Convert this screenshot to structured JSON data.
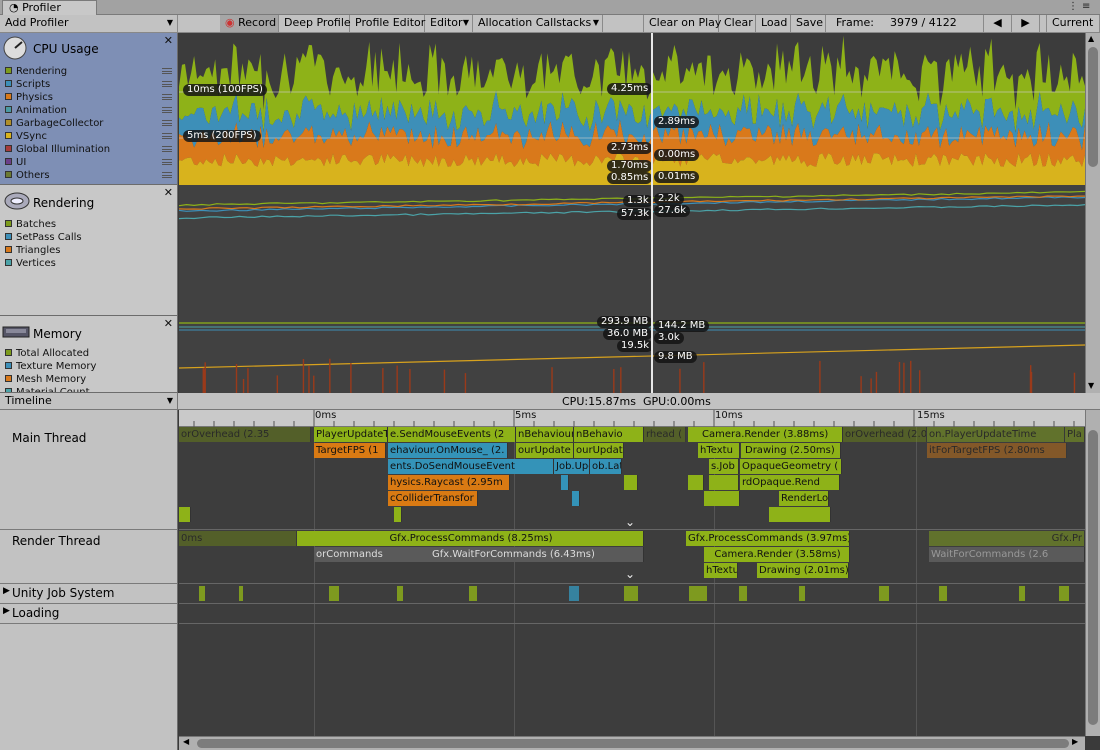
{
  "window": {
    "tab_title": "Profiler"
  },
  "toolbar": {
    "add_profiler": "Add Profiler",
    "record": "Record",
    "deep_profile": "Deep Profile",
    "profile_editor": "Profile Editor",
    "editor": "Editor",
    "allocation_callstacks": "Allocation Callstacks",
    "clear_on_play": "Clear on Play",
    "clear": "Clear",
    "load": "Load",
    "save": "Save",
    "frame_label": "Frame:",
    "frame_value": "3979 / 4122",
    "current": "Current"
  },
  "cpu": {
    "title": "CPU Usage",
    "legend": [
      "Rendering",
      "Scripts",
      "Physics",
      "Animation",
      "GarbageCollector",
      "VSync",
      "Global Illumination",
      "UI",
      "Others"
    ],
    "colors": [
      "#7d9c1c",
      "#3d8fb8",
      "#d9791b",
      "#4b9aa3",
      "#b08f2a",
      "#d8b31d",
      "#a63b3b",
      "#6b3f8a",
      "#6b7a32"
    ],
    "guide_10": "10ms (100FPS)",
    "guide_5": "5ms (200FPS)",
    "vals_left": [
      "4.25ms",
      "2.73ms",
      "1.70ms",
      "0.85ms"
    ],
    "vals_right": [
      "2.89ms",
      "0.00ms",
      "0.01ms"
    ]
  },
  "rendering": {
    "title": "Rendering",
    "legend": [
      "Batches",
      "SetPass Calls",
      "Triangles",
      "Vertices"
    ],
    "colors": [
      "#7d9c1c",
      "#3d8fb8",
      "#d9791b",
      "#4ba3a8"
    ],
    "vals_left": [
      "1.3k",
      "57.3k"
    ],
    "vals_right": [
      "2.2k",
      "27.6k"
    ]
  },
  "memory": {
    "title": "Memory",
    "legend": [
      "Total Allocated",
      "Texture Memory",
      "Mesh Memory",
      "Material Count"
    ],
    "colors": [
      "#7d9c1c",
      "#3d8fb8",
      "#d9791b",
      "#4ba3a8"
    ],
    "vals_left": [
      "293.9 MB",
      "36.0 MB",
      "19.5k"
    ],
    "vals_right": [
      "144.2 MB",
      "3.0k",
      "9.8 MB"
    ]
  },
  "timeline": {
    "view_mode": "Timeline",
    "cpu_label": "CPU:15.87ms",
    "gpu_label": "GPU:0.00ms",
    "ruler": [
      "0ms",
      "5ms",
      "10ms",
      "15ms"
    ],
    "threads": [
      "Main Thread",
      "Render Thread",
      "Unity Job System",
      "Loading"
    ],
    "main_bars": [
      "orOverhead (2.35",
      "PlayerUpdateTi",
      "e.SendMouseEvents (2",
      "nBehaviourL",
      "nBehavio",
      "rhead (",
      "Camera.Render (3.88ms)",
      "orOverhead (2.0",
      "on.PlayerUpdateTime",
      "Pla",
      "TargetFPS (1",
      "ehaviour.OnMouse_ (2.",
      "ourUpdate (1",
      "ourUpdat",
      "hTextu",
      "Drawing (2.50ms)",
      "itForTargetFPS (2.80ms",
      "ents.DoSendMouseEvent",
      "Job.Update",
      "ob.LateUp",
      "s.Job",
      "OpaqueGeometry (",
      "hysics.Raycast (2.95m",
      "rdOpaque.Rend",
      "cColliderTransfor",
      "RenderLo"
    ],
    "render_bars": [
      "0ms",
      "Gfx.ProcessCommands (8.25ms)",
      "Gfx.ProcessCommands (3.97ms)",
      "Gfx.Pr",
      "orCommands",
      "Gfx.WaitForCommands (6.43ms)",
      "WaitForCommands (2.6",
      "Camera.Render (3.58ms)",
      "hTextu",
      "Drawing (2.01ms)"
    ]
  }
}
